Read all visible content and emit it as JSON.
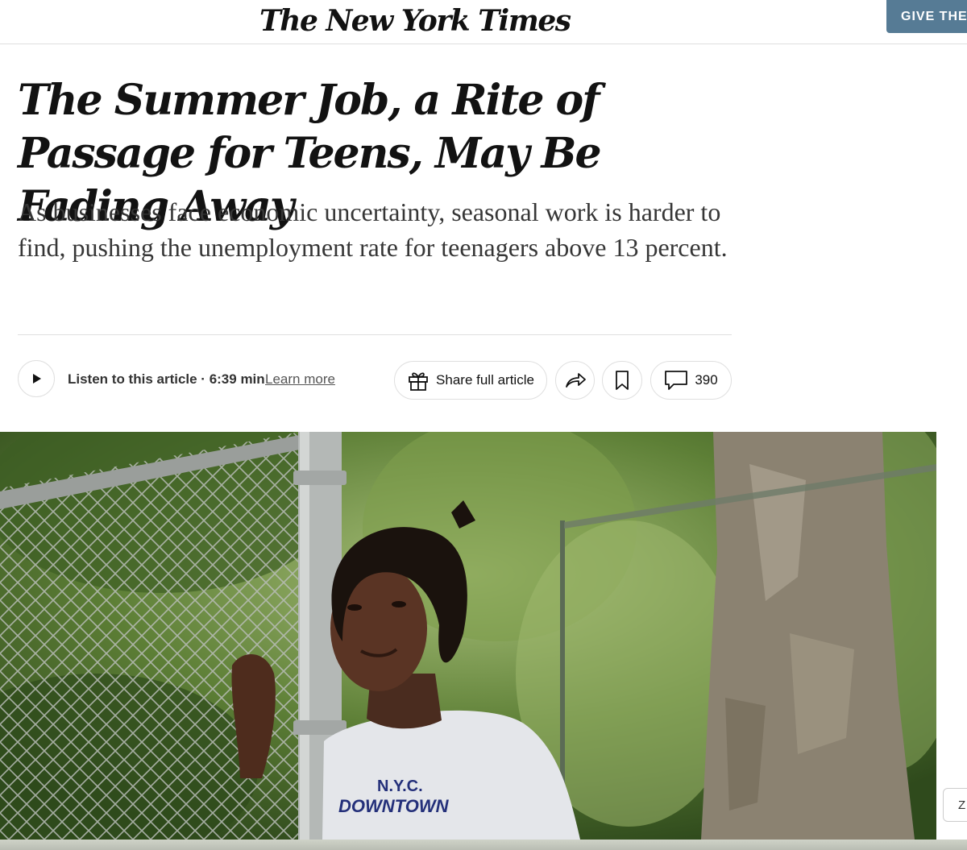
{
  "header": {
    "masthead": "The New York Times",
    "give_button": "GIVE THE T"
  },
  "article": {
    "headline": "The Summer Job, a Rite of Passage for Teens, May Be Fading Away",
    "summary": "As businesses face economic uncertainty, seasonal work is harder to find, pushing the unemployment rate for teenagers above 13 percent."
  },
  "audio": {
    "listen_label": "Listen to this article · 6:39 min",
    "learn_more": "Learn more"
  },
  "actions": {
    "share_full_label": "Share full article",
    "comment_count": "390"
  },
  "photo": {
    "shirt_text_line1": "N.Y.C.",
    "shirt_text_line2": "DOWNTOWN"
  },
  "side_tab": {
    "label": "Z"
  },
  "colors": {
    "give_button_bg": "#567b95",
    "text_primary": "#121212",
    "summary_text": "#363636"
  }
}
